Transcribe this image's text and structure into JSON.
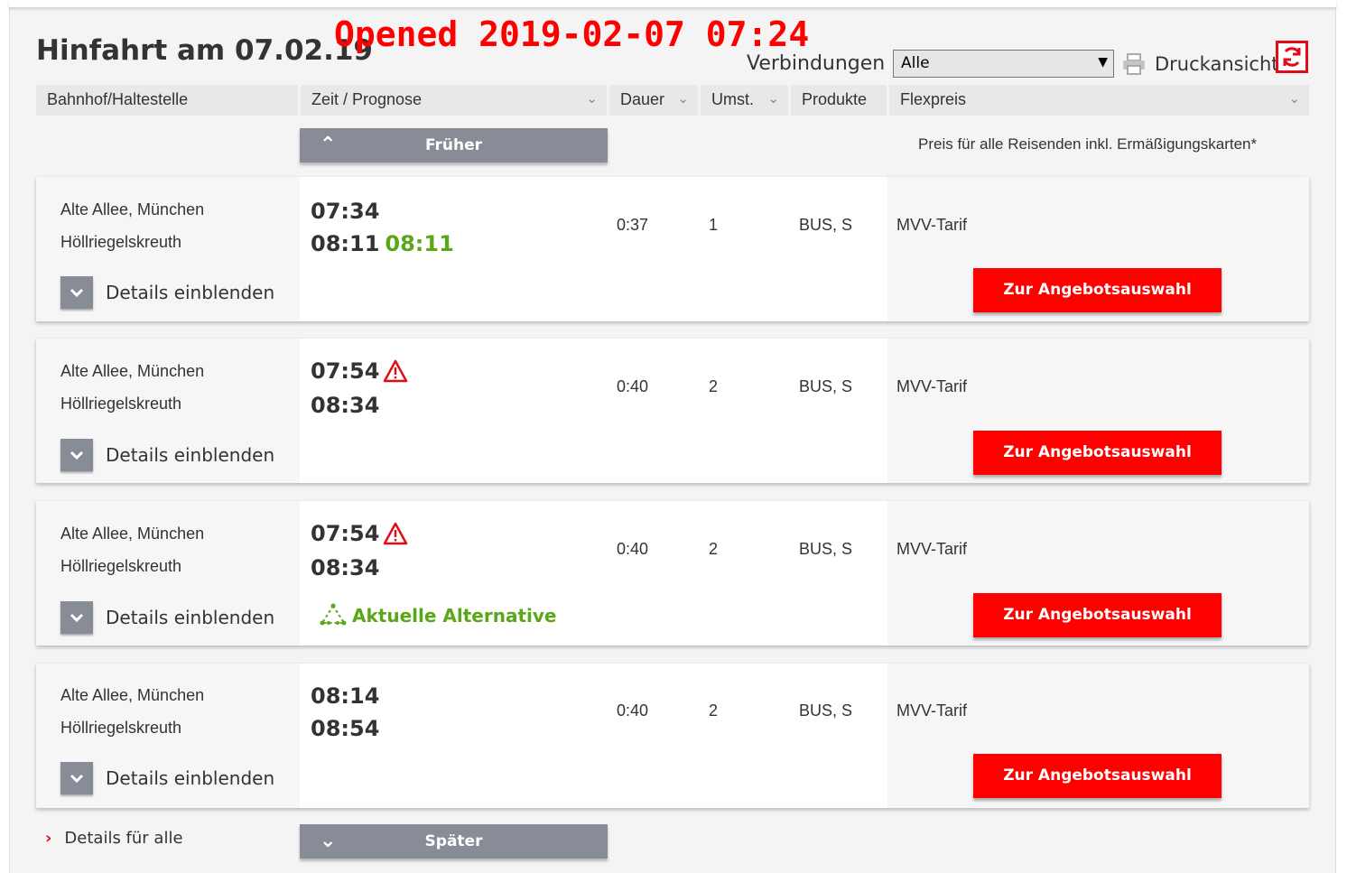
{
  "page": {
    "title": "Hinfahrt am 07.02.19",
    "stamp": "Opened 2019-02-07 07:24",
    "connections_label": "Verbindungen",
    "connections_value": "Alle",
    "print_label": "Druckansicht"
  },
  "columns": {
    "station": "Bahnhof/Haltestelle",
    "time": "Zeit / Prognose",
    "duration": "Dauer",
    "changes": "Umst.",
    "products": "Produkte",
    "fare": "Flexpreis"
  },
  "earlier_label": "Früher",
  "later_label": "Später",
  "price_note": "Preis für alle Reisenden inkl. Ermäßigungskarten*",
  "details_all_label": "Details für alle",
  "connections": [
    {
      "from": "Alte Allee, München",
      "to": "Höllriegelskreuth",
      "dep": "07:34",
      "arr": "08:11",
      "arr_prognosis": "08:11",
      "duration": "0:37",
      "changes": "1",
      "products": "BUS, S",
      "fare": "MVV-Tarif",
      "details_label": "Details einblenden",
      "offer_label": "Zur Angebotsauswahl"
    },
    {
      "from": "Alte Allee, München",
      "to": "Höllriegelskreuth",
      "dep": "07:54",
      "arr": "08:34",
      "duration": "0:40",
      "changes": "2",
      "products": "BUS, S",
      "fare": "MVV-Tarif",
      "details_label": "Details einblenden",
      "offer_label": "Zur Angebotsauswahl",
      "icon": "warning-icon"
    },
    {
      "from": "Alte Allee, München",
      "to": "Höllriegelskreuth",
      "dep": "07:54",
      "arr": "08:34",
      "duration": "0:40",
      "changes": "2",
      "products": "BUS, S",
      "fare": "MVV-Tarif",
      "details_label": "Details einblenden",
      "offer_label": "Zur Angebotsauswahl",
      "icon": "warning-icon",
      "alternative_label": "Aktuelle Alternative"
    },
    {
      "from": "Alte Allee, München",
      "to": "Höllriegelskreuth",
      "dep": "08:14",
      "arr": "08:54",
      "duration": "0:40",
      "changes": "2",
      "products": "BUS, S",
      "fare": "MVV-Tarif",
      "details_label": "Details einblenden",
      "offer_label": "Zur Angebotsauswahl"
    }
  ],
  "colors": {
    "brand_red": "#ff0000",
    "prognosis_green": "#5aa71a",
    "button_gray": "#878c96"
  }
}
